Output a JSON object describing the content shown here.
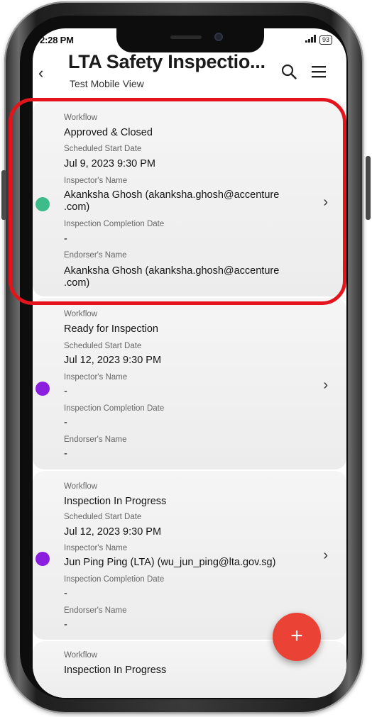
{
  "status_bar": {
    "time": "2:28 PM",
    "battery": "93"
  },
  "header": {
    "back_icon": "chevron-left-icon",
    "title": "LTA Safety Inspectio...",
    "subtitle": "Test Mobile View"
  },
  "labels": {
    "workflow": "Workflow",
    "scheduled_start": "Scheduled Start Date",
    "inspector": "Inspector's Name",
    "completion": "Inspection Completion Date",
    "endorser": "Endorser's Name"
  },
  "cards": [
    {
      "workflow": "Approved & Closed",
      "scheduled_start": "Jul 9, 2023 9:30 PM",
      "inspector_line1": "Akanksha Ghosh (akanksha.ghosh@accenture",
      "inspector_line2": ".com)",
      "completion": "-",
      "endorser_line1": "Akanksha Ghosh (akanksha.ghosh@accenture",
      "endorser_line2": ".com)",
      "status_color": "#3dbb8a"
    },
    {
      "workflow": "Ready for Inspection",
      "scheduled_start": "Jul 12, 2023 9:30 PM",
      "inspector": "-",
      "completion": "-",
      "endorser": "-",
      "status_color": "#8b1fe0"
    },
    {
      "workflow": "Inspection In Progress",
      "scheduled_start": "Jul 12, 2023 9:30 PM",
      "inspector": "Jun Ping Ping (LTA) (wu_jun_ping@lta.gov.sg)",
      "completion": "-",
      "endorser": "-",
      "status_color": "#8b1fe0"
    },
    {
      "workflow": "Inspection In Progress"
    }
  ],
  "fab": {
    "label": "+"
  },
  "colors": {
    "highlight": "#e3141b",
    "fab": "#ea4335"
  }
}
